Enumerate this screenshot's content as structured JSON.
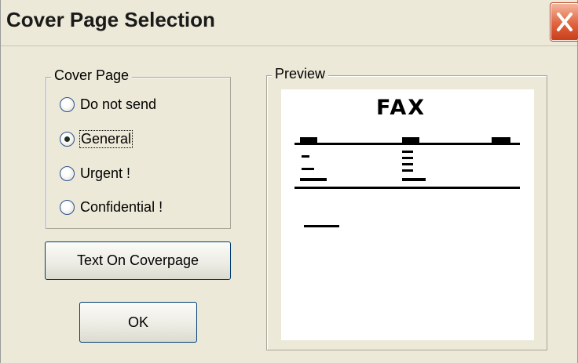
{
  "window": {
    "title": "Cover Page Selection"
  },
  "cover_page_group": {
    "legend": "Cover Page",
    "options": [
      {
        "label": "Do not send",
        "selected": false
      },
      {
        "label": "General",
        "selected": true
      },
      {
        "label": "Urgent !",
        "selected": false
      },
      {
        "label": "Confidential !",
        "selected": false
      }
    ]
  },
  "buttons": {
    "text_on_coverpage": "Text On Coverpage",
    "ok": "OK"
  },
  "preview_group": {
    "legend": "Preview",
    "page_heading": "FAX"
  },
  "icons": {
    "close": "close-icon"
  }
}
